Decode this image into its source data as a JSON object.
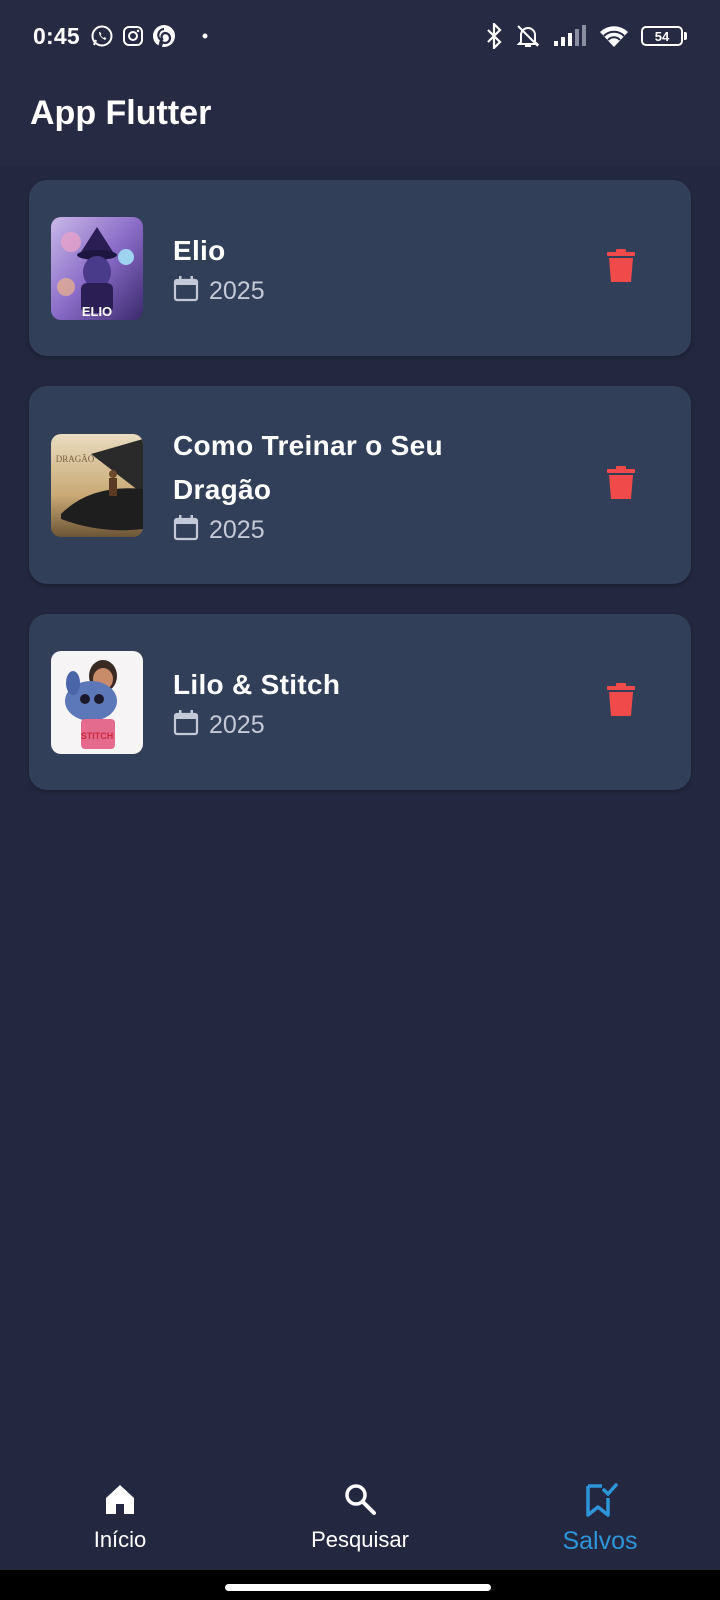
{
  "status_bar": {
    "time": "0:45",
    "battery": "54",
    "icons_left": [
      "whatsapp-icon",
      "instagram-icon",
      "pinterest-icon",
      "dot-icon"
    ],
    "icons_right": [
      "bluetooth-icon",
      "bell-off-icon",
      "signal-icon",
      "wifi-icon",
      "battery-icon"
    ]
  },
  "app_bar": {
    "title": "App Flutter"
  },
  "saved_movies": [
    {
      "title": "Elio",
      "year": "2025",
      "icon": "calendar-icon",
      "action_icon": "trash-icon"
    },
    {
      "title": "Como Treinar o Seu Dragão",
      "year": "2025",
      "icon": "calendar-icon",
      "action_icon": "trash-icon"
    },
    {
      "title": "Lilo & Stitch",
      "year": "2025",
      "icon": "calendar-icon",
      "action_icon": "trash-icon"
    }
  ],
  "bottom_nav": {
    "items": [
      {
        "label": "Início",
        "icon": "home-icon"
      },
      {
        "label": "Pesquisar",
        "icon": "search-icon"
      },
      {
        "label": "Salvos",
        "icon": "bookmark-check-icon",
        "active": true
      }
    ]
  },
  "colors": {
    "background": "#232840",
    "app_bar": "#262a43",
    "card": "#323f59",
    "delete": "#f04a4a",
    "active_nav": "#2d95d8"
  }
}
